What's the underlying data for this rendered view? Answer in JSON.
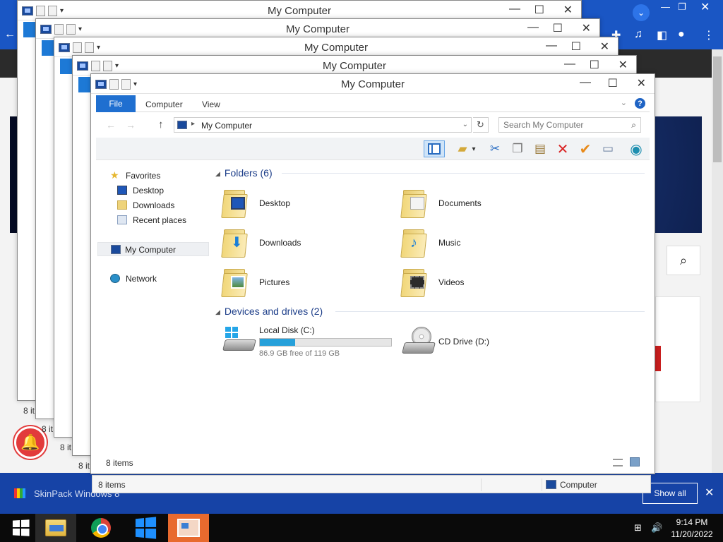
{
  "window_title": "My Computer",
  "ribbon": {
    "file": "File",
    "computer": "Computer",
    "view": "View"
  },
  "address": {
    "path": "My Computer",
    "search_placeholder": "Search My Computer"
  },
  "nav": {
    "favorites": "Favorites",
    "desktop": "Desktop",
    "downloads": "Downloads",
    "recent": "Recent places",
    "my_computer": "My Computer",
    "network": "Network"
  },
  "folders_group": "Folders (6)",
  "folders": [
    {
      "name": "Desktop",
      "icon": "desktop-folder-icon"
    },
    {
      "name": "Documents",
      "icon": "documents-folder-icon"
    },
    {
      "name": "Downloads",
      "icon": "downloads-folder-icon"
    },
    {
      "name": "Music",
      "icon": "music-folder-icon"
    },
    {
      "name": "Pictures",
      "icon": "pictures-folder-icon"
    },
    {
      "name": "Videos",
      "icon": "videos-folder-icon"
    }
  ],
  "devices_group": "Devices and drives (2)",
  "drives": [
    {
      "name": "Local Disk (C:)",
      "free_text": "86.9 GB free of 119 GB",
      "used_fraction": 0.27,
      "icon": "hard-disk-icon"
    },
    {
      "name": "CD Drive (D:)",
      "icon": "cd-drive-icon"
    }
  ],
  "status": {
    "items": "8 items",
    "location": "Computer"
  },
  "back_status_fragments": [
    "8 it",
    "8 it",
    "8 it",
    "8 it",
    "8 it"
  ],
  "notification": {
    "text": "SkinPack Windows 8",
    "show_all": "Show all"
  },
  "clock": {
    "time": "9:14 PM",
    "date": "11/20/2022"
  },
  "colors": {
    "accent": "#1f6fd0",
    "taskbar": "#0a0a0a",
    "drive_fill": "#26a0da",
    "notif_bar": "#1643a6"
  }
}
